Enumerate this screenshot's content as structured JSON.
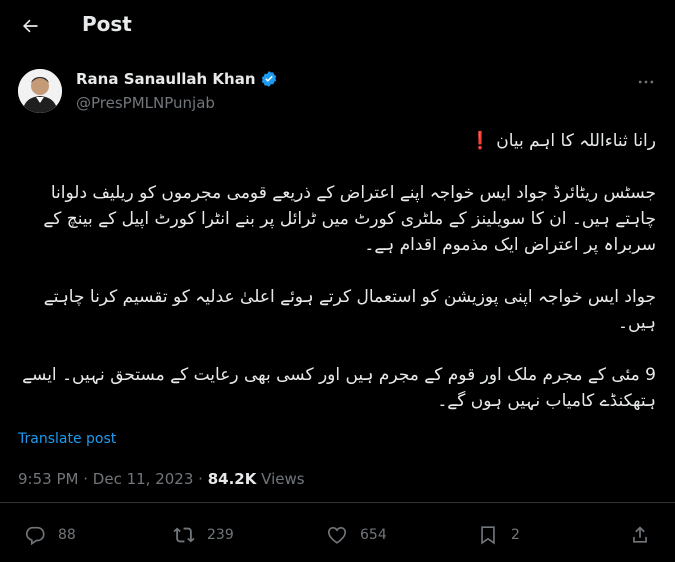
{
  "header": {
    "title": "Post"
  },
  "author": {
    "name": "Rana Sanaullah Khan",
    "handle": "@PresPMLNPunjab"
  },
  "post": {
    "title_line": "رانا ثناءاللہ کا اہم بیان ❗️",
    "paragraph1": "جسٹس ریٹائرڈ جواد ایس خواجہ اپنے اعتراض کے ذریعے قومی مجرموں کو ریلیف دلوانا چاہتے ہیں۔ ان کا سویلینز کے ملٹری کورٹ میں ٹرائل پر بنے انٹرا کورٹ اپیل کے بینچ کے سربراہ پر اعتراض ایک مذموم اقدام ہے۔",
    "paragraph2": "جواد ایس خواجہ اپنی پوزیشن کو استعمال کرتے ہوئے اعلیٰ عدلیہ کو تقسیم کرنا چاہتے ہیں۔",
    "paragraph3": "9 مئی کے مجرم ملک اور قوم کے مجرم ہیں اور کسی بھی رعایت کے مستحق نہیں۔ ایسے ہتھکنڈے کامیاب نہیں ہوں گے۔"
  },
  "translate_label": "Translate post",
  "meta": {
    "time": "9:53 PM",
    "date": "Dec 11, 2023",
    "views_count": "84.2K",
    "views_label": "Views",
    "dot": "·"
  },
  "actions": {
    "replies": "88",
    "reposts": "239",
    "likes": "654",
    "bookmarks": "2"
  },
  "colors": {
    "background": "#000000",
    "accent": "#1d9bf0",
    "muted": "#71767b",
    "text": "#e7e9ea"
  }
}
